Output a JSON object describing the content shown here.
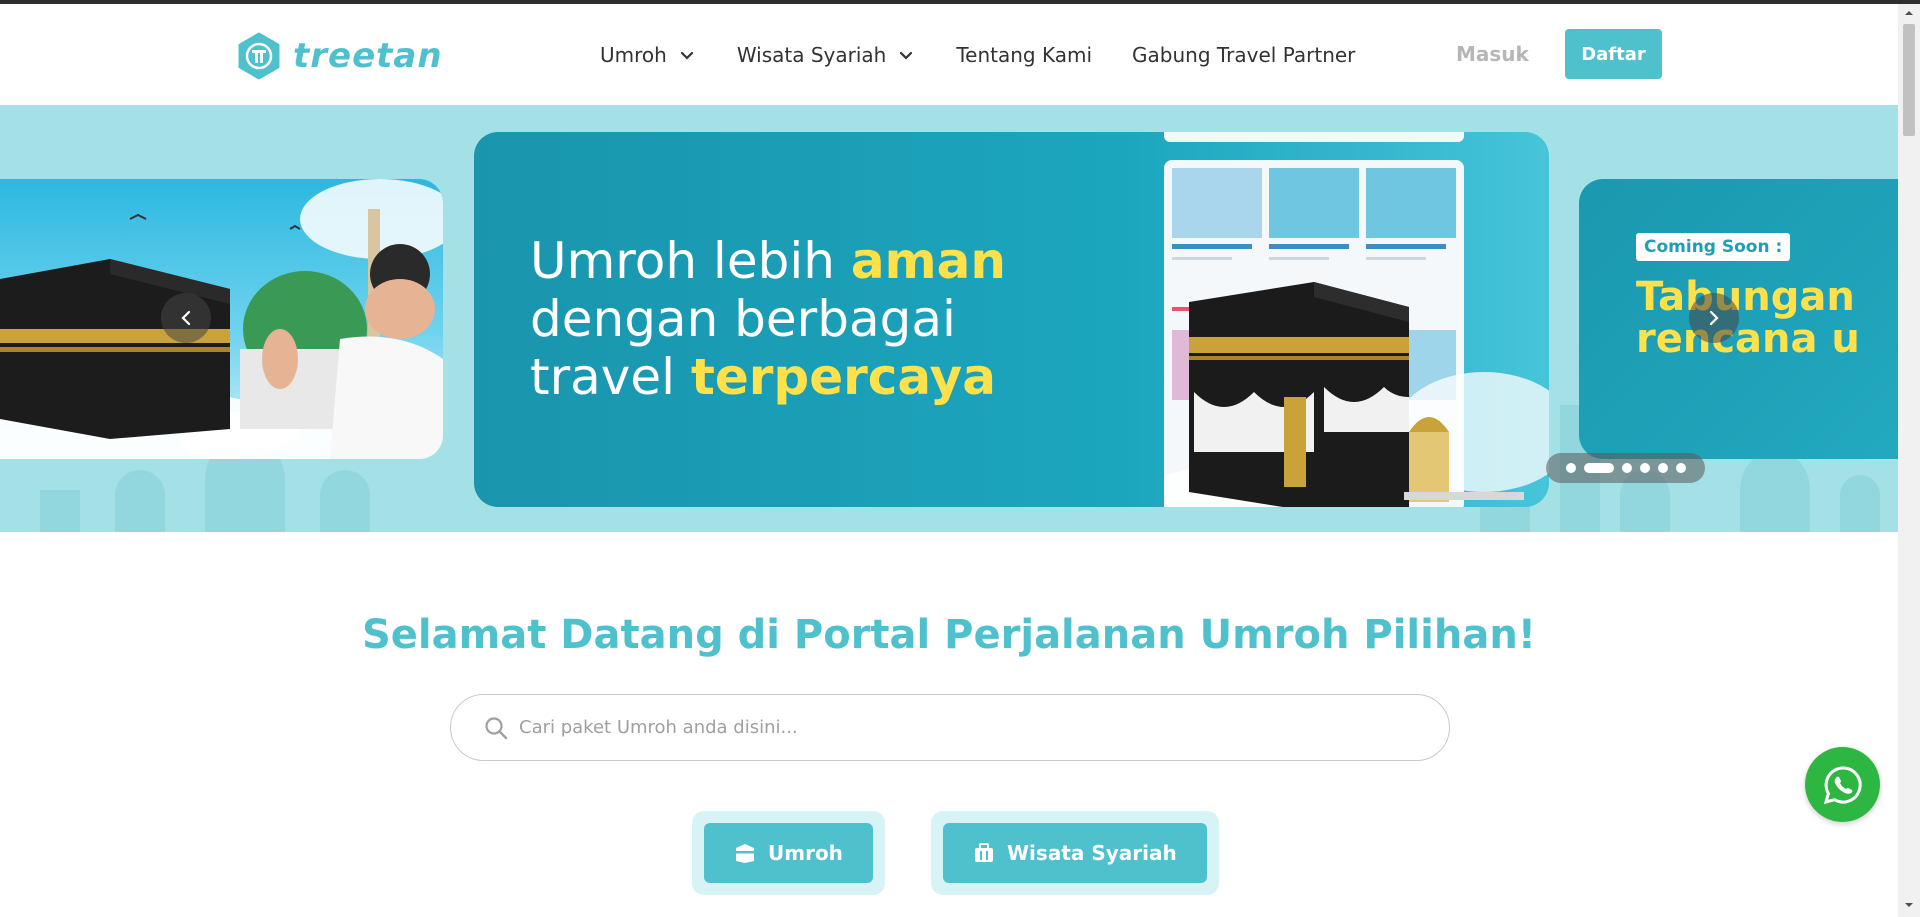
{
  "brand": {
    "name": "treetan",
    "accent": "#4fc1cd"
  },
  "nav": {
    "items": [
      {
        "label": "Umroh",
        "dropdown": true
      },
      {
        "label": "Wisata Syariah",
        "dropdown": true
      },
      {
        "label": "Tentang Kami",
        "dropdown": false
      },
      {
        "label": "Gabung Travel Partner",
        "dropdown": false
      }
    ],
    "login_label": "Masuk",
    "register_label": "Daftar"
  },
  "hero": {
    "main": {
      "line1_plain": "Umroh lebih ",
      "line1_highlight": "aman",
      "line2_plain": "dengan berbagai",
      "line3_plain": "travel ",
      "line3_highlight": "terpercaya"
    },
    "next_slide": {
      "badge": "Coming Soon :",
      "line1": "Tabungan",
      "line2": "rencana u"
    },
    "dots": {
      "count": 6,
      "active_index": 1
    }
  },
  "welcome_title": "Selamat Datang di Portal Perjalanan Umroh Pilihan!",
  "search": {
    "placeholder": "Cari paket Umroh anda disini..."
  },
  "categories": [
    {
      "label": "Umroh",
      "icon": "kaaba-icon"
    },
    {
      "label": "Wisata Syariah",
      "icon": "suitcase-icon"
    }
  ]
}
